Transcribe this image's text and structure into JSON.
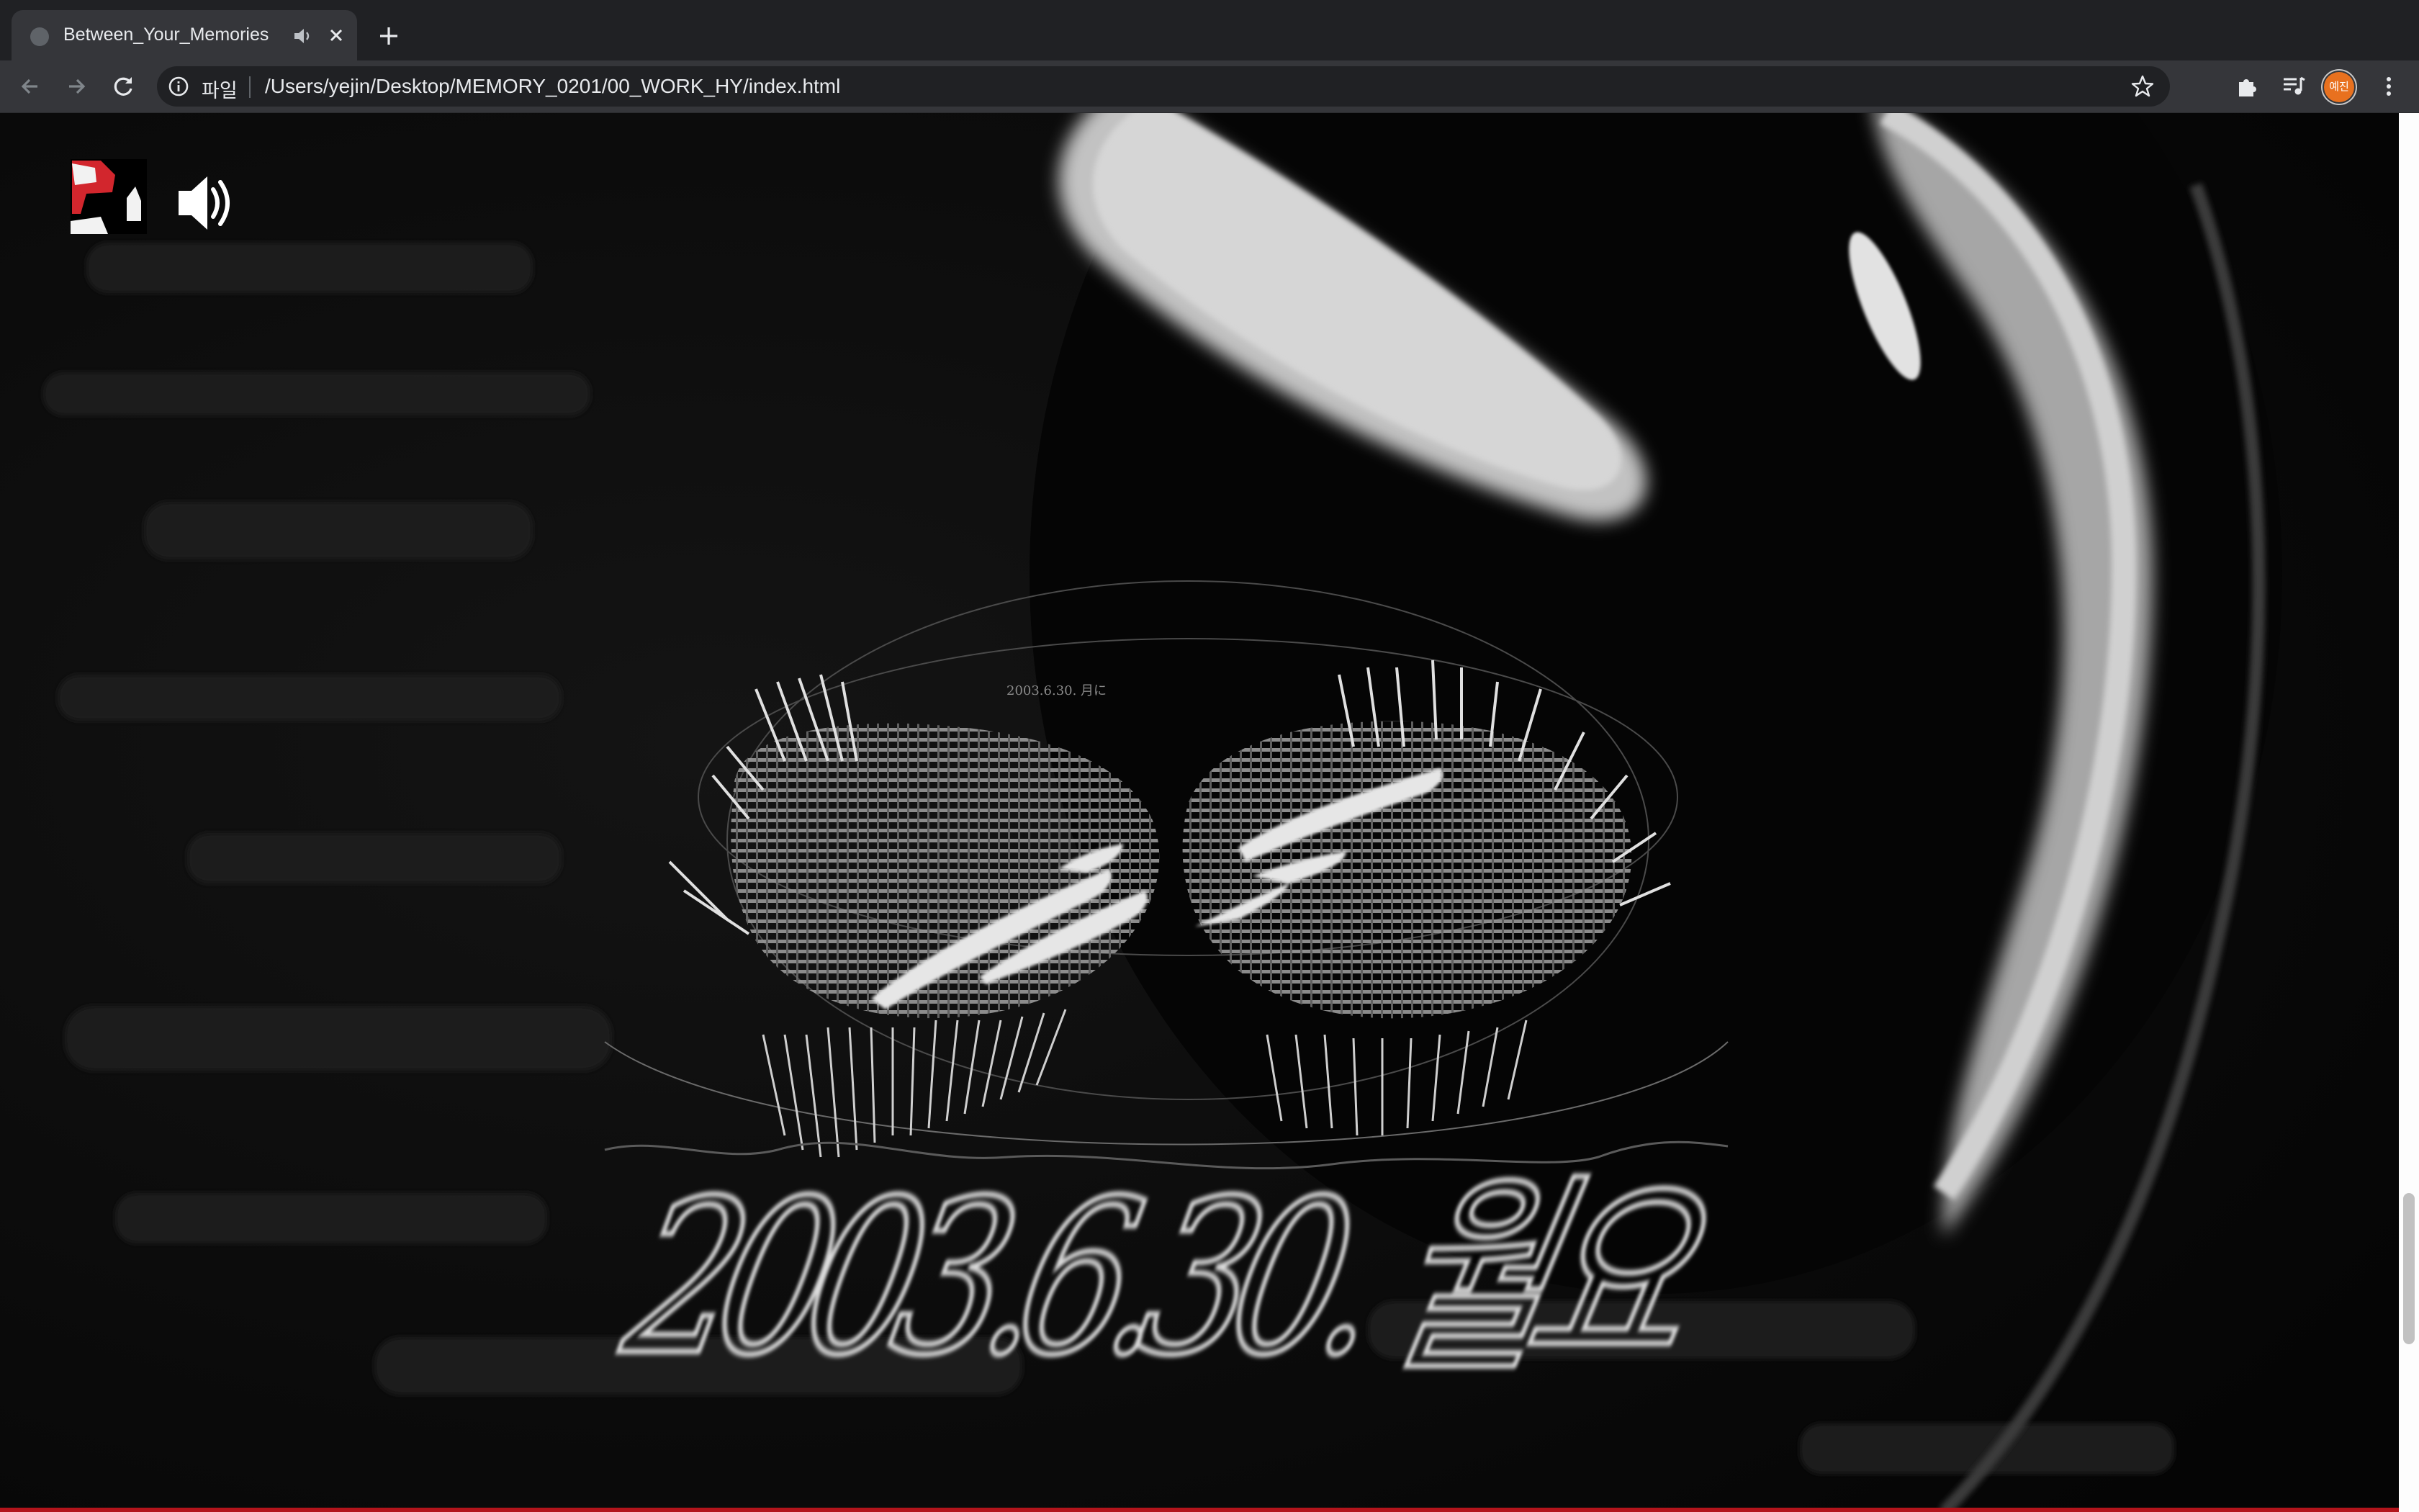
{
  "browser": {
    "tab": {
      "title": "Between_Your_Memories",
      "audio_icon": "speaker-icon",
      "close_icon": "close-icon"
    },
    "new_tab_icon": "plus-icon",
    "toolbar": {
      "back_icon": "arrow-left-icon",
      "forward_icon": "arrow-right-icon",
      "reload_icon": "reload-icon",
      "site_info_icon": "info-icon",
      "scheme_label": "파일",
      "url": "/Users/yejin/Desktop/MEMORY_0201/00_WORK_HY/index.html",
      "bookmark_icon": "star-icon",
      "extensions_icon": "puzzle-icon",
      "media_icon": "playlist-icon",
      "profile_initials": "예진",
      "menu_icon": "kebab-menu-icon"
    }
  },
  "page": {
    "logo_icon": "logo-icon",
    "sound_icon": "speaker-on-icon",
    "artwork": {
      "date_caption": "2003.6.30. 月に",
      "headline": "2003.6.30. 월요"
    }
  },
  "colors": {
    "tabstrip": "#202124",
    "toolbar": "#35363a",
    "omnibox": "#202124",
    "page_background": "#000000",
    "accent_red": "#b3141b",
    "profile": "#e8711f"
  }
}
